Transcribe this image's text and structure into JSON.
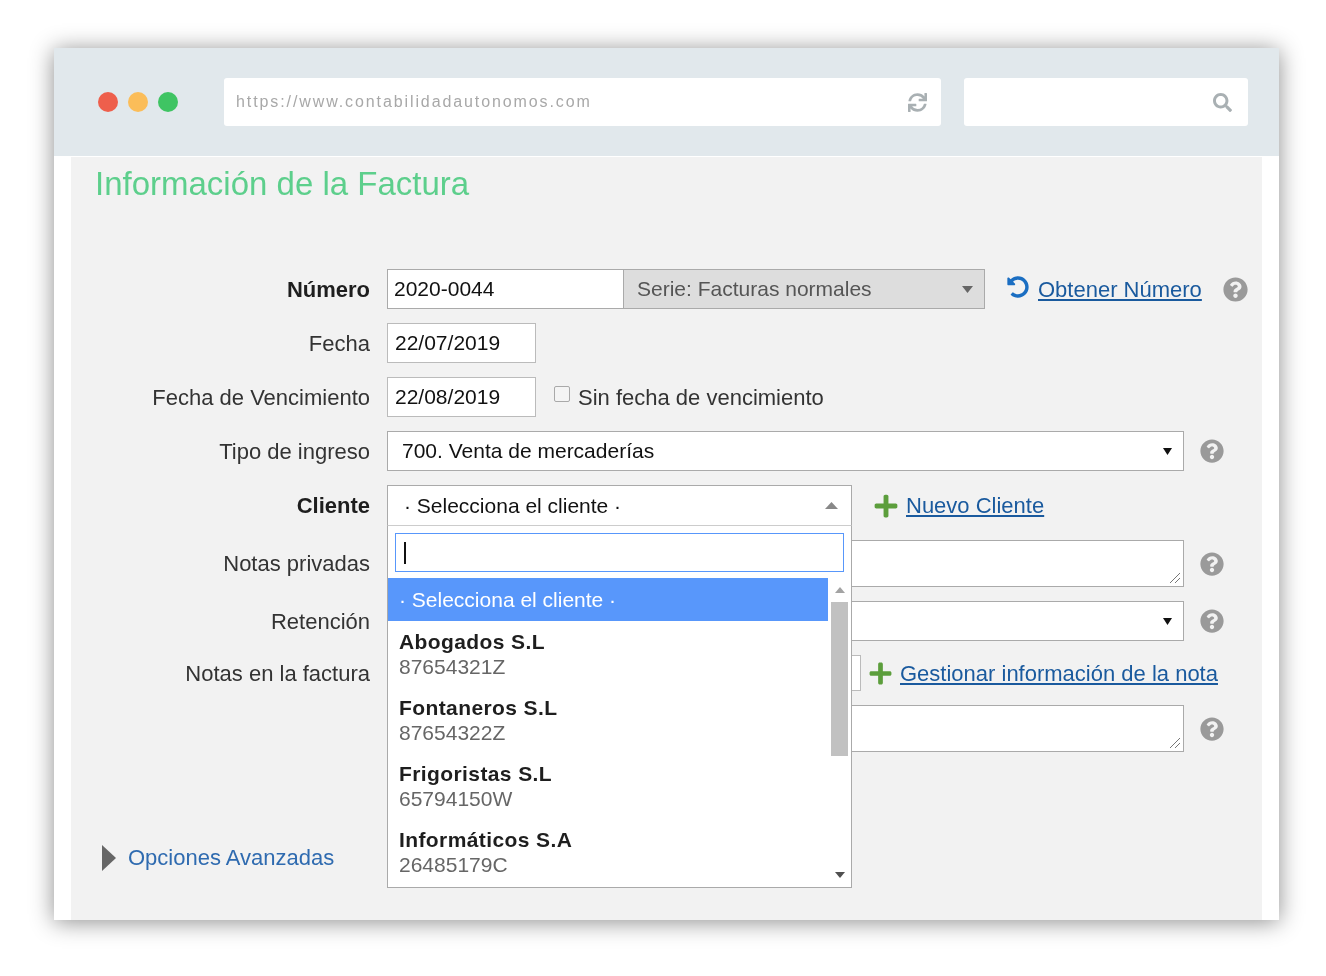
{
  "browser": {
    "url": "https://www.contabilidadautonomos.com"
  },
  "title": "Información de la Factura",
  "rows": [
    {
      "kind": "number",
      "label": "Número",
      "bold": true,
      "value": "2020-0044",
      "series": "Serie: Facturas normales",
      "link": "Obtener Número",
      "help": true
    },
    {
      "kind": "date",
      "label": "Fecha",
      "bold": false,
      "value": "22/07/2019",
      "help": false
    },
    {
      "kind": "date",
      "label": "Fecha de Vencimiento",
      "bold": false,
      "value": "22/08/2019",
      "checkbox": {
        "label": "Sin fecha de vencimiento",
        "checked": false
      },
      "help": false
    },
    {
      "kind": "select",
      "label": "Tipo de ingreso",
      "bold": false,
      "value": "700. Venta de mercaderías",
      "help": true
    },
    {
      "kind": "combo",
      "label": "Cliente",
      "bold": true,
      "value": "· Selecciona el cliente ·",
      "expanded": true,
      "link": "Nuevo Cliente",
      "help": false,
      "dropdown": {
        "search": {
          "focused": true
        },
        "options": [
          {
            "kind": "placeholder",
            "name": "· Selecciona el cliente ·",
            "selected": true
          },
          {
            "kind": "client",
            "name": "Abogados S.L",
            "id": "87654321Z",
            "selected": false
          },
          {
            "kind": "client",
            "name": "Fontaneros S.L",
            "id": "87654322Z",
            "selected": false
          },
          {
            "kind": "client",
            "name": "Frigoristas S.L",
            "id": "65794150W",
            "selected": false
          },
          {
            "kind": "client",
            "name": "Informáticos S.A",
            "id": "26485179C",
            "selected": false
          }
        ]
      }
    },
    {
      "kind": "textarea",
      "label": "Notas privadas",
      "bold": false,
      "help": true
    },
    {
      "kind": "select",
      "label": "Retención",
      "bold": false,
      "help": true
    },
    {
      "kind": "notes",
      "label": "Notas en la factura",
      "bold": false,
      "link": "Gestionar información de la nota",
      "help": false
    },
    {
      "kind": "textarea",
      "help": true
    }
  ],
  "advanced": {
    "label": "Opciones Avanzadas",
    "expanded": false
  }
}
